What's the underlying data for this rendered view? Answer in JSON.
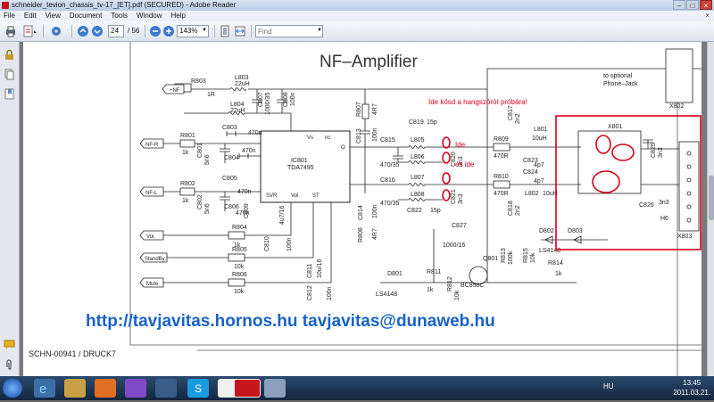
{
  "window": {
    "title": "schneider_tevion_chassis_tv-17_[ET].pdf (SECURED) - Adobe Reader",
    "controls": {
      "min": "–",
      "max": "□",
      "close": "×"
    }
  },
  "menu": [
    "File",
    "Edit",
    "View",
    "Document",
    "Tools",
    "Window",
    "Help"
  ],
  "menu_close": "×",
  "toolbar": {
    "page_current": "24",
    "page_total": "/ 56",
    "zoom": "143%",
    "find_placeholder": "Find",
    "icons": [
      "print-icon",
      "create-pdf-icon",
      "attach-icon",
      "page-up-icon",
      "page-down-icon",
      "zoom-out-icon",
      "zoom-in-icon",
      "fit-page-icon",
      "fit-width-icon"
    ]
  },
  "schematic": {
    "heading": "NF–Amplifier",
    "annotation_red": "Ide kösd a hangszórót próbára!",
    "ide": "Ide",
    "es_ide": "és ide",
    "labels": {
      "nf_plus": "+NF",
      "nf_r": "NF-R",
      "nf_l": "NF-L",
      "vol": "Vol.",
      "standby": "StandBy",
      "mute": "Mute",
      "r803": "R803",
      "r803v": "1R",
      "l803": "L803",
      "l803v": "22uH",
      "l804": "L804",
      "l804v": "22uH",
      "c807": "C807",
      "c807v": "1000/35",
      "c808": "C808",
      "c808v": "100n",
      "r807": "R807",
      "r807v": "4R7",
      "c813": "C813",
      "c813v": "100n",
      "r801": "R801",
      "r801v": "1k",
      "c801": "C801",
      "c801v": "5n6",
      "c803": "C803",
      "c803v": "470n",
      "c804": "C804",
      "c804v": "470n",
      "ic801": "IC801",
      "ic801v": "TDA7495",
      "r802": "R802",
      "r802v": "1k",
      "c802": "C802",
      "c802v": "5n6",
      "c805": "C805",
      "c805v": "470n",
      "c806": "C806",
      "c806v": "470n",
      "c809": "C809",
      "c809v": "4u7/16",
      "c810": "C810",
      "c810v": "100n",
      "r804": "R804",
      "r804v": "1k",
      "r805": "R805",
      "r805v": "10k",
      "r806": "R806",
      "r806v": "10k",
      "c811": "C811",
      "c811v": "10u/16",
      "c812": "C812",
      "c812v": "100n",
      "c814": "C814",
      "c814v": "100n",
      "r808": "R808",
      "r808v": "4R7",
      "c815": "C815",
      "c815v": "470/35",
      "c816": "C816",
      "c816v": "470/35",
      "c819": "C819",
      "c819v": "15p",
      "c822": "C822",
      "c822v": "15p",
      "l805": "L805",
      "l806": "L806",
      "l807": "L807",
      "l808": "L808",
      "c820": "C820",
      "c820v": "3n3",
      "c821": "C821",
      "c821v": "3n3",
      "r809": "R809",
      "r809v": "470R",
      "r810": "R810",
      "r810v": "470R",
      "c817": "C817",
      "c817v": "2n2",
      "c818": "C818",
      "c818v": "2n2",
      "l801": "L801",
      "l801v": "10uH",
      "l802": "L802",
      "l802v": "10uH",
      "c823": "C823",
      "c823v": "4p7",
      "c824": "C824",
      "c824v": "4p7",
      "c825": "C825",
      "c825v": "3n3",
      "c826": "C826",
      "c826v": "3n3",
      "x801": "X801",
      "x802": "X802",
      "x803": "X803",
      "h6": "H6",
      "to_optional": "to optional",
      "phone_jack": "Phone–Jack",
      "c827": "C827",
      "c827v": "1000/16",
      "q801": "Q801",
      "q801v": "BC858C",
      "d801": "D801",
      "d801v": "LS4148",
      "d802": "D802",
      "d802v": "LS4148",
      "d803": "D803",
      "r811": "R811",
      "r811v": "1k",
      "r812": "R812",
      "r812v": "10k",
      "r813": "R813",
      "r813v": "100k",
      "r814": "R814",
      "r814v": "1k",
      "r815": "R815",
      "r815v": "10k",
      "vs": "Vs",
      "nc": "nc",
      "svr": "SVR",
      "vol_pin": "Vol",
      "st": "ST",
      "o_pin": "O"
    },
    "watermark": "http://tavjavitas.hornos.hu   tavjavitas@dunaweb.hu",
    "footer": "SCHN-00941 / DRUCK7"
  },
  "taskbar": {
    "lang": "HU",
    "time": "13:45",
    "date": "2011.03.21."
  },
  "colors": {
    "annotation": "#d9001b",
    "watermark": "#1762c9",
    "ink": "#222222"
  }
}
